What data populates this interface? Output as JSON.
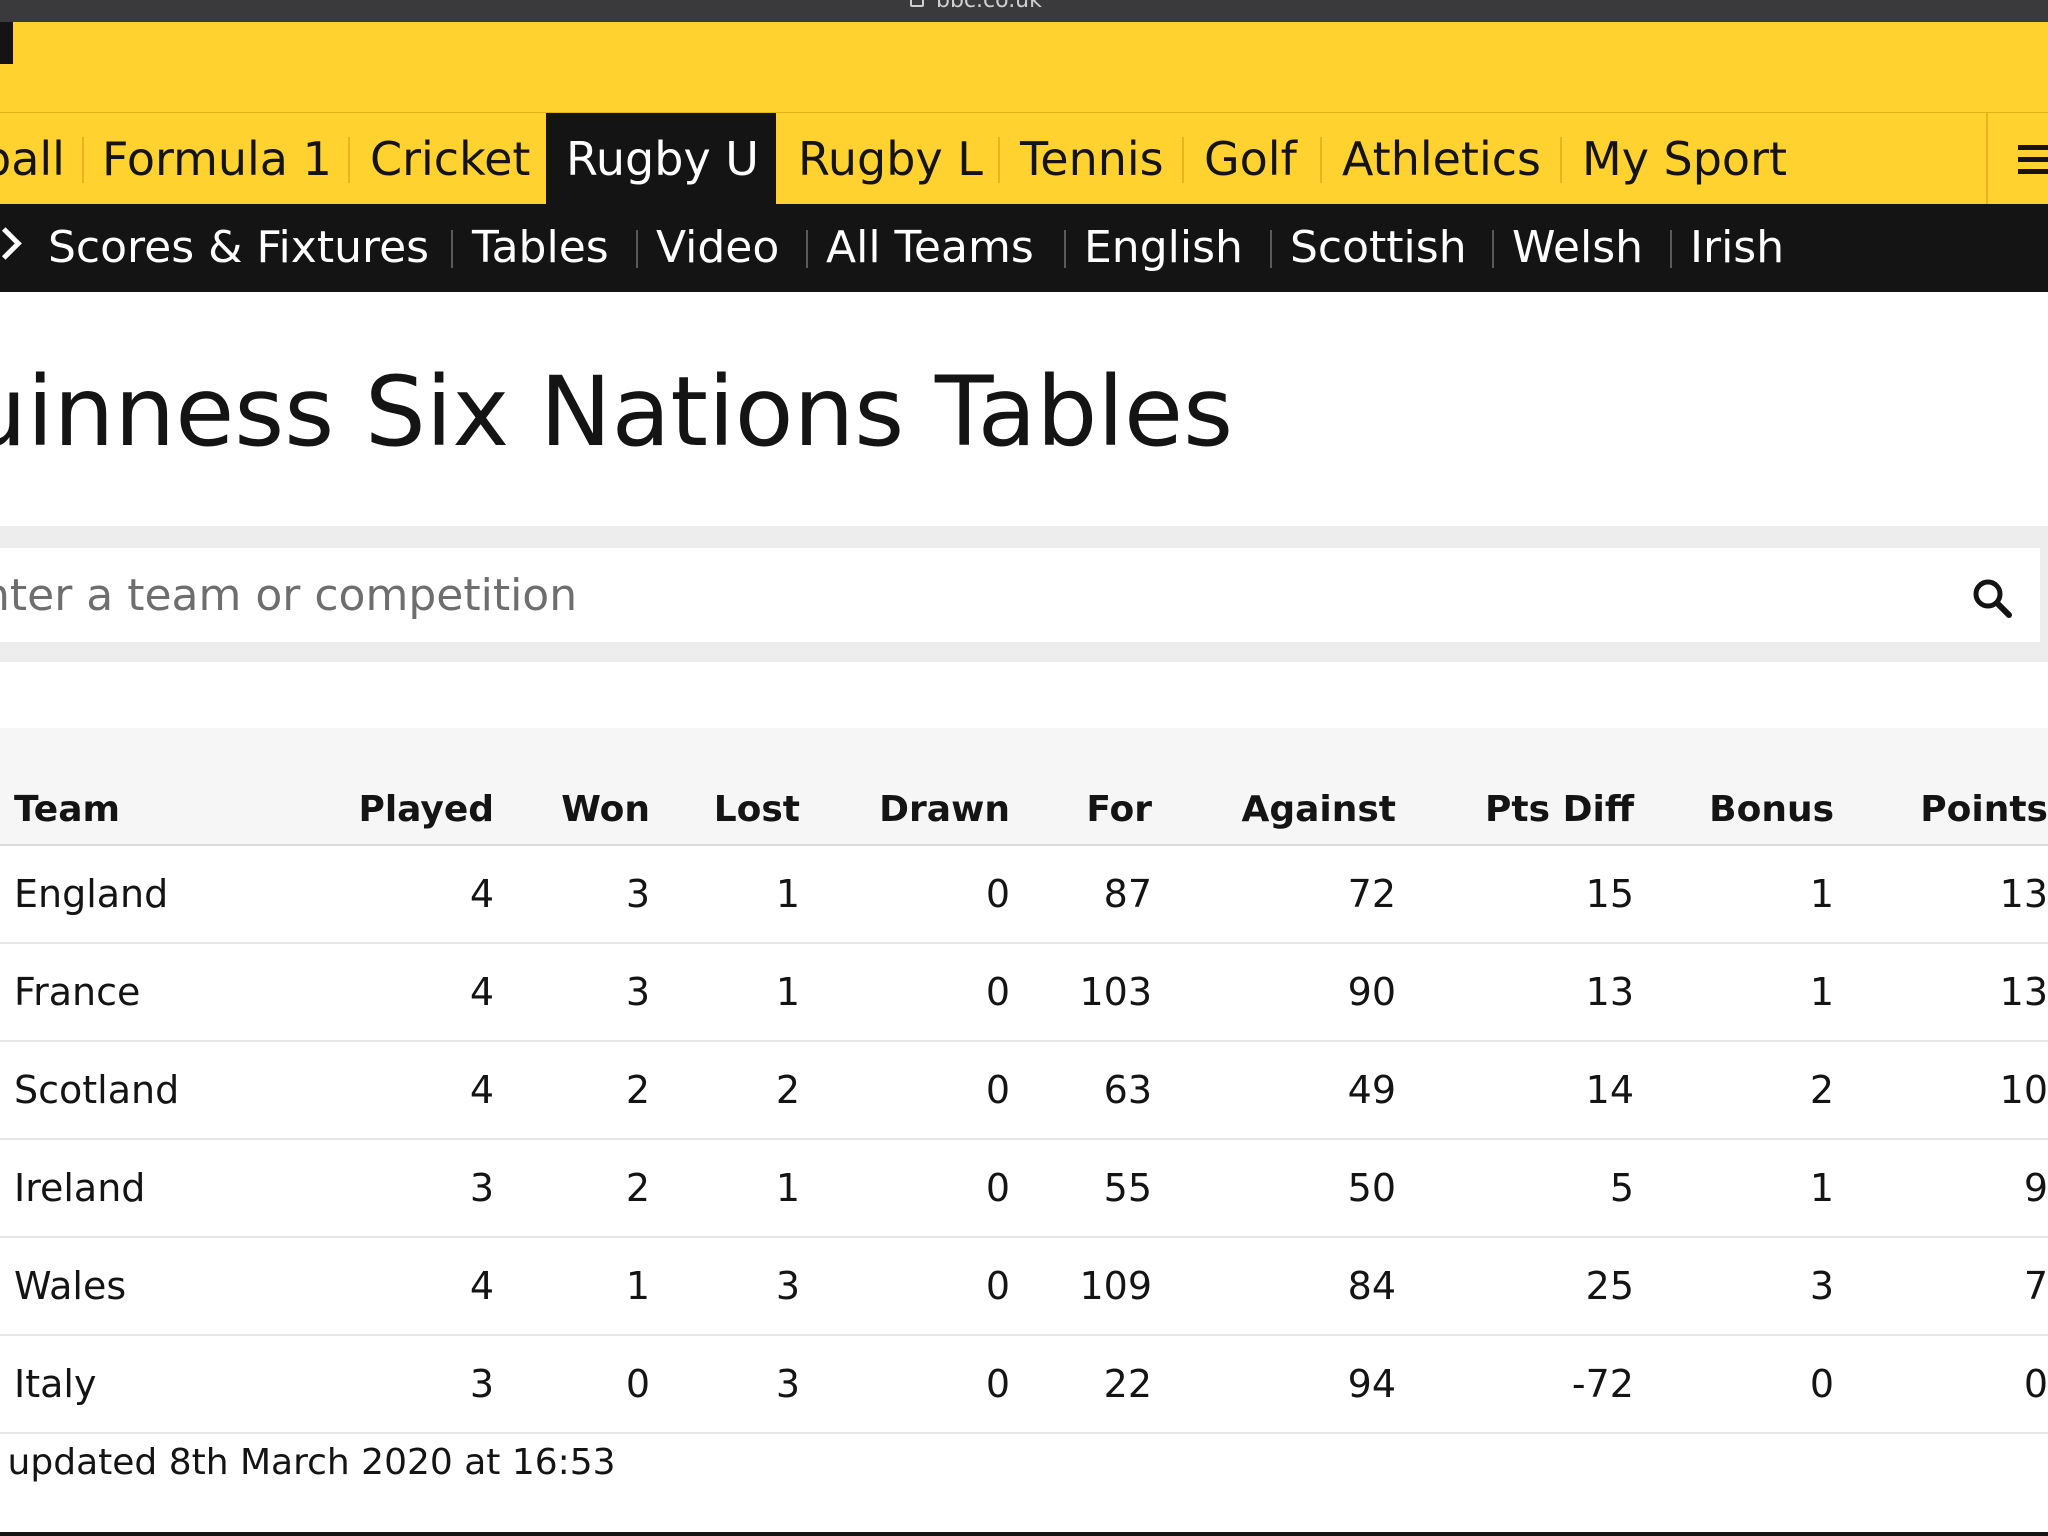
{
  "browser": {
    "url": "bbc.co.uk"
  },
  "sport_nav": {
    "items": [
      {
        "label": "ball",
        "active": false
      },
      {
        "label": "Formula 1",
        "active": false
      },
      {
        "label": "Cricket",
        "active": false
      },
      {
        "label": "Rugby U",
        "active": true
      },
      {
        "label": "Rugby L",
        "active": false
      },
      {
        "label": "Tennis",
        "active": false
      },
      {
        "label": "Golf",
        "active": false
      },
      {
        "label": "Athletics",
        "active": false
      },
      {
        "label": "My Sport",
        "active": false
      }
    ],
    "menu_icon": "hamburger-menu-icon"
  },
  "sub_nav": {
    "items": [
      "Scores & Fixtures",
      "Tables",
      "Video",
      "All Teams",
      "English",
      "Scottish",
      "Welsh",
      "Irish"
    ]
  },
  "page": {
    "title": "uinness Six Nations Tables"
  },
  "search": {
    "placeholder": "nter a team or competition",
    "icon": "search-icon"
  },
  "table": {
    "headers": [
      "Team",
      "Played",
      "Won",
      "Lost",
      "Drawn",
      "For",
      "Against",
      "Pts Diff",
      "Bonus",
      "Points"
    ],
    "rows": [
      [
        "England",
        "4",
        "3",
        "1",
        "0",
        "87",
        "72",
        "15",
        "1",
        "13"
      ],
      [
        "France",
        "4",
        "3",
        "1",
        "0",
        "103",
        "90",
        "13",
        "1",
        "13"
      ],
      [
        "Scotland",
        "4",
        "2",
        "2",
        "0",
        "63",
        "49",
        "14",
        "2",
        "10"
      ],
      [
        "Ireland",
        "3",
        "2",
        "1",
        "0",
        "55",
        "50",
        "5",
        "1",
        "9"
      ],
      [
        "Wales",
        "4",
        "1",
        "3",
        "0",
        "109",
        "84",
        "25",
        "3",
        "7"
      ],
      [
        "Italy",
        "3",
        "0",
        "3",
        "0",
        "22",
        "94",
        "-72",
        "0",
        "0"
      ]
    ],
    "updated": "t updated 8th March 2020 at 16:53"
  },
  "colors": {
    "brand_yellow": "#ffd230",
    "dark": "#141414",
    "search_bg": "#ededed"
  }
}
